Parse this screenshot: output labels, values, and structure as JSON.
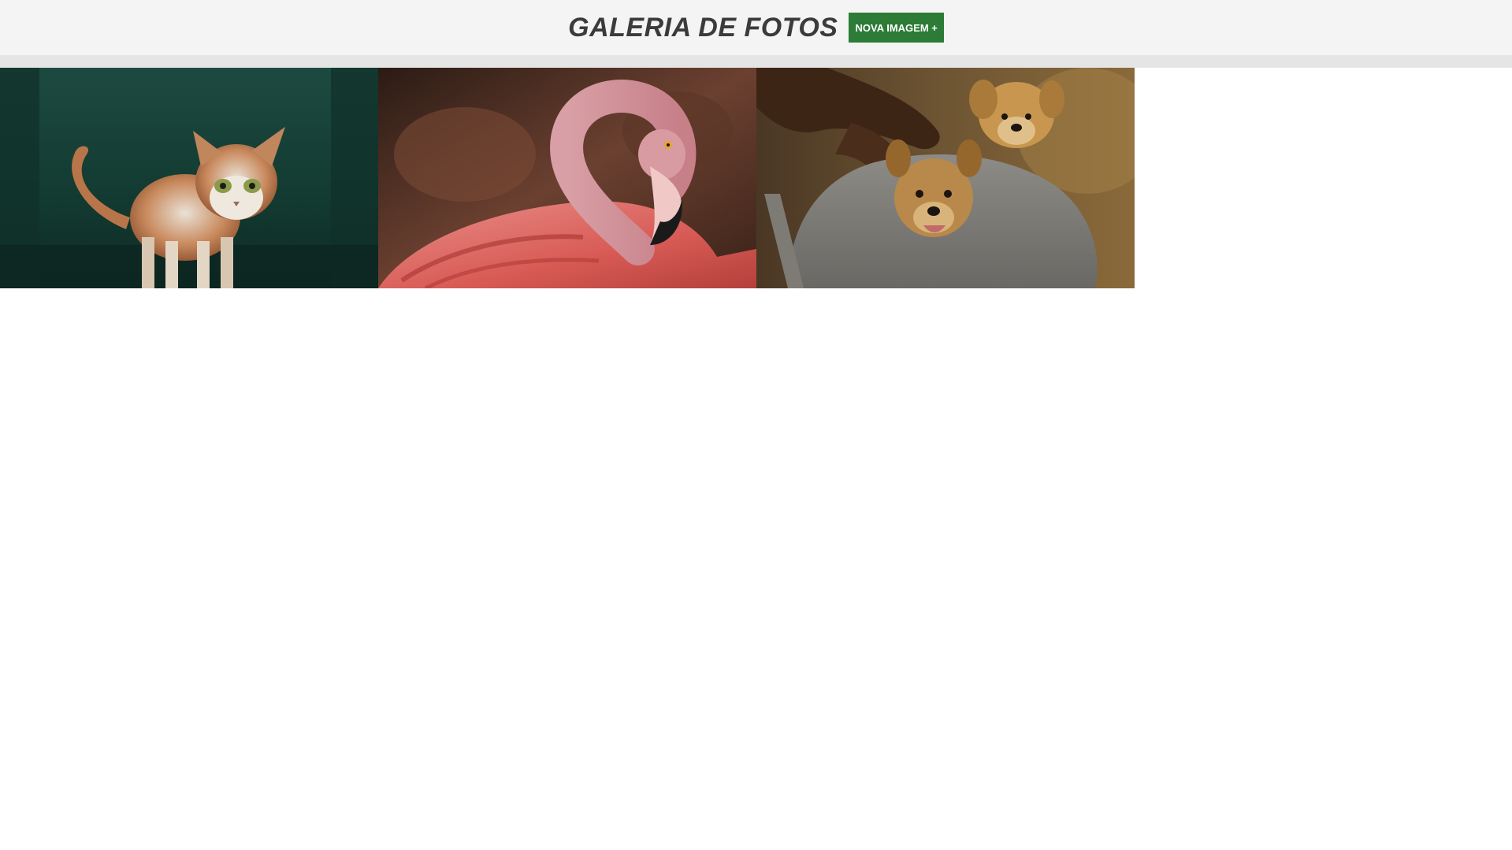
{
  "header": {
    "title": "GALERIA DE FOTOS",
    "new_image_button": "NOVA IMAGEM +"
  },
  "gallery": {
    "photos": [
      {
        "subject": "cat",
        "icon": "cat-photo"
      },
      {
        "subject": "flamingo",
        "icon": "flamingo-photo"
      },
      {
        "subject": "puppies",
        "icon": "puppies-photo"
      }
    ]
  },
  "colors": {
    "header_bg": "#f4f4f4",
    "strip_bg": "#e5e5e5",
    "button_bg": "#2c7b36",
    "title_color": "#3b3b3b"
  }
}
